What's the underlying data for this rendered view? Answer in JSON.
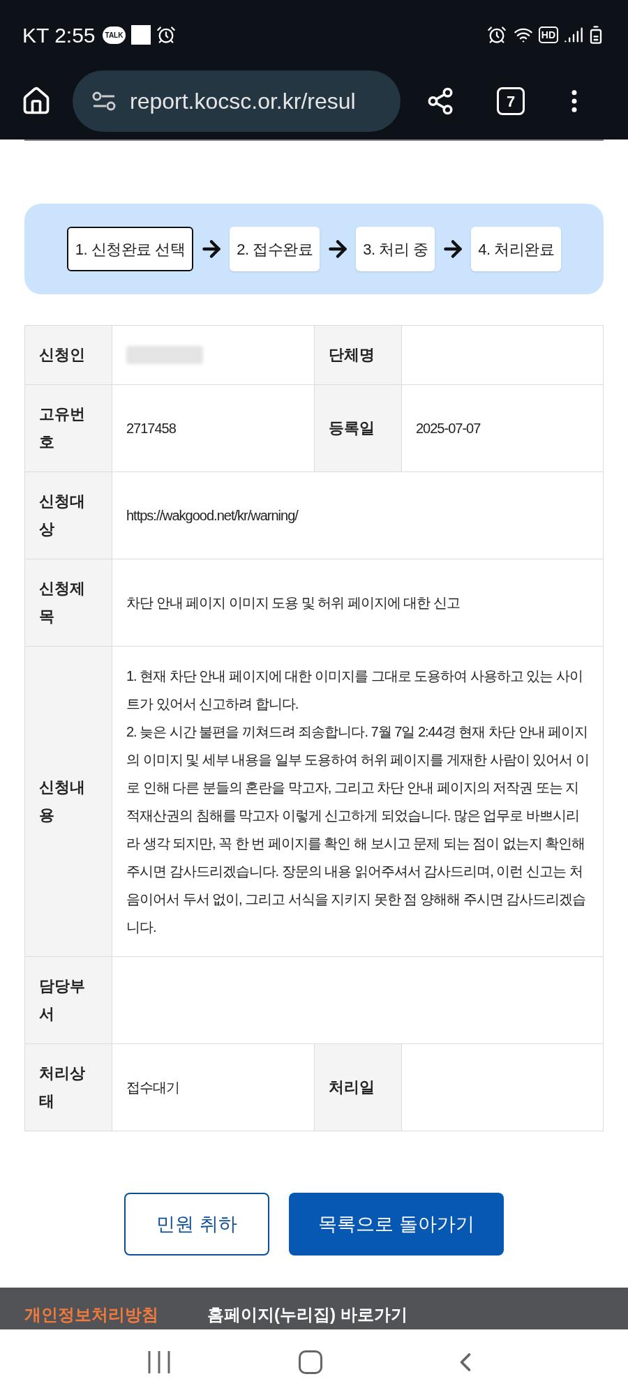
{
  "status_bar": {
    "carrier_time": "KT 2:55",
    "talk_badge": "TALK",
    "hd_badge": "HD"
  },
  "browser": {
    "url": "report.kocsc.or.kr/resul",
    "tab_count": "7"
  },
  "steps": [
    {
      "label": "1. 신청완료 선택",
      "selected": true
    },
    {
      "label": "2. 접수완료",
      "selected": false
    },
    {
      "label": "3. 처리 중",
      "selected": false
    },
    {
      "label": "4. 처리완료",
      "selected": false
    }
  ],
  "table": {
    "rows": [
      {
        "kind": "pair",
        "cells": [
          {
            "label": "신청인",
            "redacted": true
          },
          {
            "label": "단체명"
          }
        ]
      },
      {
        "kind": "pair",
        "cells": [
          {
            "label": "고유번호",
            "value": "2717458"
          },
          {
            "label": "등록일",
            "value": "2025-07-07"
          }
        ]
      },
      {
        "kind": "single",
        "cells": [
          {
            "label": "신청대상",
            "value": "https://wakgood.net/kr/warning/"
          }
        ]
      },
      {
        "kind": "single",
        "cells": [
          {
            "label": "신청제목",
            "value": "차단 안내 페이지 이미지 도용 및 허위 페이지에 대한 신고"
          }
        ]
      },
      {
        "kind": "single",
        "cells": [
          {
            "label": "신청내용",
            "value": "1. 현재 차단 안내 페이지에 대한 이미지를 그대로 도용하여 사용하고 있는 사이트가 있어서 신고하려 합니다.\n2. 늦은 시간 불편을 끼쳐드려 죄송합니다. 7월 7일 2:44경 현재 차단 안내 페이지의 이미지 및 세부 내용을 일부 도용하여 허위 페이지를 게재한 사람이 있어서 이로 인해 다른 분들의 혼란을 막고자, 그리고 차단 안내 페이지의 저작권 또는 지적재산권의 침해를 막고자 이렇게 신고하게 되었습니다. 많은 업무로 바쁘시리라 생각 되지만, 꼭 한 번 페이지를 확인 해 보시고 문제 되는 점이 없는지 확인해주시면 감사드리겠습니다. 장문의 내용 읽어주셔서 감사드리며, 이런 신고는 처음이어서 두서 없이, 그리고 서식을 지키지 못한 점 양해해 주시면 감사드리겠습니다."
          }
        ]
      },
      {
        "kind": "single",
        "cells": [
          {
            "label": "담당부서"
          }
        ]
      },
      {
        "kind": "pair",
        "cells": [
          {
            "label": "처리상태",
            "value": "접수대기"
          },
          {
            "label": "처리일"
          }
        ]
      }
    ]
  },
  "buttons": [
    {
      "label": "민원 취하",
      "kind": "outline"
    },
    {
      "label": "목록으로 돌아가기",
      "kind": "primary"
    }
  ],
  "footer": {
    "links": [
      {
        "label": "개인정보처리방침",
        "kind": "highlight"
      },
      {
        "label": "홈페이지(누리집) 바로가기",
        "kind": "plain"
      }
    ]
  }
}
